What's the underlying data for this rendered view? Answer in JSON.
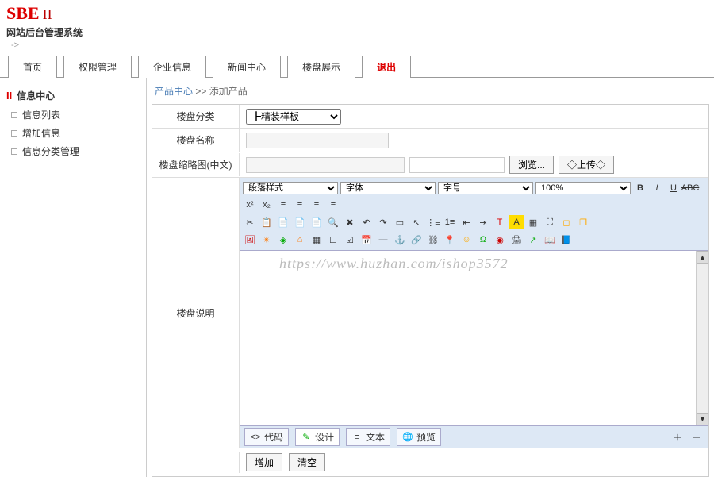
{
  "brand": {
    "main": "SBE",
    "sub": "II",
    "tagline": "网站后台管理系统"
  },
  "tabs": [
    "首页",
    "权限管理",
    "企业信息",
    "新闻中心",
    "楼盘展示",
    "退出"
  ],
  "sidebar": {
    "heading": "信息中心",
    "items": [
      "信息列表",
      "增加信息",
      "信息分类管理"
    ]
  },
  "breadcrumb": {
    "section": "产品中心",
    "page": "添加产品"
  },
  "form": {
    "category_label": "楼盘分类",
    "category_value": "┣精装样板",
    "name_label": "楼盘名称",
    "thumb_label": "楼盘缩略图(中文)",
    "browse_btn": "浏览...",
    "upload_btn": "◇上传◇",
    "desc_label": "楼盘说明"
  },
  "editor": {
    "style_sel": "段落样式",
    "font_sel": "字体",
    "size_sel": "字号",
    "zoom": "100%",
    "footer_tabs": {
      "code": "代码",
      "design": "设计",
      "text": "文本",
      "preview": "预览"
    }
  },
  "actions": {
    "add": "增加",
    "clear": "清空"
  },
  "watermark": "https://www.huzhan.com/ishop3572"
}
